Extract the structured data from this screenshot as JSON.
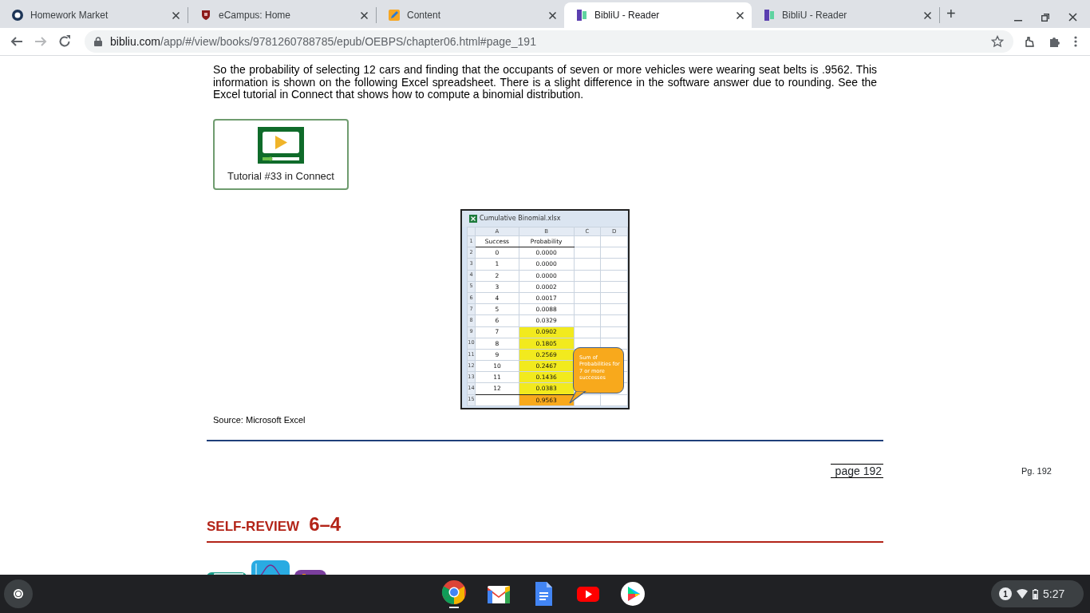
{
  "browser": {
    "tabs": [
      {
        "title": "Homework Market",
        "selected": false
      },
      {
        "title": "eCampus: Home",
        "selected": false
      },
      {
        "title": "Content",
        "selected": false
      },
      {
        "title": "BibliU - Reader",
        "selected": true
      },
      {
        "title": "BibliU - Reader",
        "selected": false
      }
    ],
    "new_tab": "+",
    "address": {
      "host": "bibliu.com",
      "path": "/app/#/view/books/9781260788785/epub/OEBPS/chapter06.html#page_191"
    },
    "forward_disabled": true
  },
  "page": {
    "paragraph": "So the probability of selecting 12 cars and finding that the occupants of seven or more vehicles were wearing seat belts is .9562. This information is shown on the following Excel spreadsheet. There is a slight difference in the software answer due to rounding. See the Excel tutorial in Connect that shows how to compute a binomial distribution.",
    "tutorial": {
      "label": "Tutorial #33 in Connect"
    },
    "spreadsheet": {
      "title": "Cumulative Binomial.xlsx",
      "columns": [
        "A",
        "B",
        "C",
        "D"
      ],
      "rows": [
        {
          "num": "1",
          "a": "Success",
          "b": "Probability"
        },
        {
          "num": "2",
          "a": "0",
          "b": "0.0000"
        },
        {
          "num": "3",
          "a": "1",
          "b": "0.0000"
        },
        {
          "num": "4",
          "a": "2",
          "b": "0.0000"
        },
        {
          "num": "5",
          "a": "3",
          "b": "0.0002"
        },
        {
          "num": "6",
          "a": "4",
          "b": "0.0017"
        },
        {
          "num": "7",
          "a": "5",
          "b": "0.0088"
        },
        {
          "num": "8",
          "a": "6",
          "b": "0.0329"
        },
        {
          "num": "9",
          "a": "7",
          "b": "0.0902",
          "color": "#f2ea1e"
        },
        {
          "num": "10",
          "a": "8",
          "b": "0.1805",
          "color": "#f2ea1e"
        },
        {
          "num": "11",
          "a": "9",
          "b": "0.2569",
          "color": "#f2ea1e"
        },
        {
          "num": "12",
          "a": "10",
          "b": "0.2467",
          "color": "#f2ea1e"
        },
        {
          "num": "13",
          "a": "11",
          "b": "0.1436",
          "color": "#f2ea1e"
        },
        {
          "num": "14",
          "a": "12",
          "b": "0.0383",
          "color": "#f2ea1e"
        },
        {
          "num": "15",
          "a": "",
          "b": "0.9563",
          "color": "#f8a91c"
        }
      ],
      "callout": "Sum of Probabilities for 7 or more successes"
    },
    "source": "Source: Microsoft Excel",
    "page_label": "page 192",
    "side_label": "Pg. 192",
    "heading": {
      "label": "SELF-REVIEW",
      "number": "6–4"
    }
  },
  "taskbar": {
    "apps": [
      {
        "kind": "chrome",
        "active": true
      },
      {
        "kind": "gmail",
        "active": false
      },
      {
        "kind": "docs",
        "active": false
      },
      {
        "kind": "youtube",
        "active": false
      },
      {
        "kind": "play",
        "active": false
      }
    ],
    "notifications": "1",
    "time": "5:27"
  }
}
